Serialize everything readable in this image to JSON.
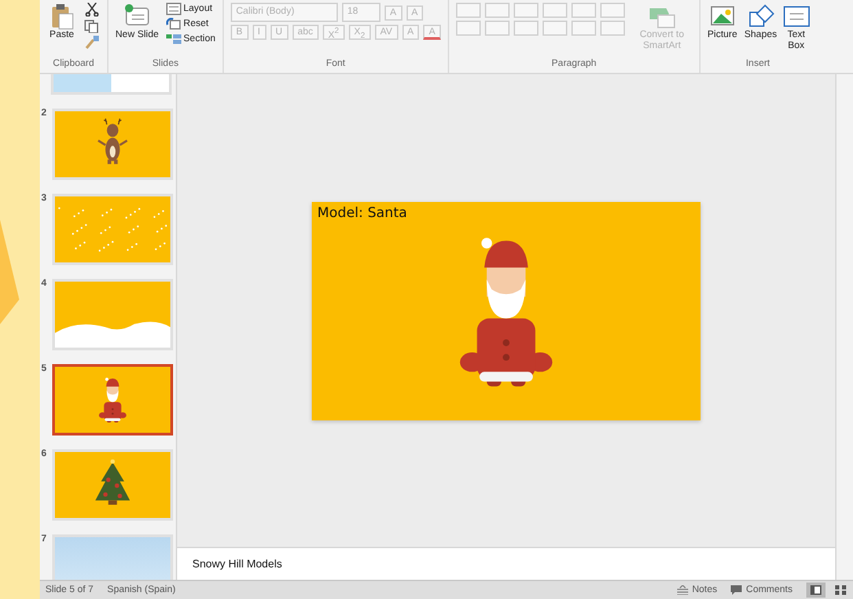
{
  "ribbon": {
    "clipboard": {
      "paste": "Paste",
      "label": "Clipboard"
    },
    "slides": {
      "new_slide": "New Slide",
      "layout": "Layout",
      "reset": "Reset",
      "section": "Section",
      "label": "Slides"
    },
    "font": {
      "disabled": true,
      "font_name": "Calibri (Body)",
      "font_size": "18",
      "size_buttons": [
        "A",
        "A"
      ],
      "format_buttons": [
        "B",
        "I",
        "U",
        "abc",
        "X$^{2}$",
        "X$_{2}$",
        "AV",
        "A"
      ],
      "font_color": "A",
      "label": "Font"
    },
    "paragraph": {
      "disabled": true,
      "convert": "Convert to SmartArt",
      "label": "Paragraph"
    },
    "insert": {
      "picture": "Picture",
      "shapes": "Shapes",
      "text_box": "Text Box",
      "label": "Insert"
    }
  },
  "slides": [
    {
      "kind": "collage",
      "selected": false
    },
    {
      "number": "2",
      "kind": "reindeer",
      "selected": false
    },
    {
      "number": "3",
      "kind": "snow",
      "selected": false
    },
    {
      "number": "4",
      "kind": "hills",
      "selected": false
    },
    {
      "number": "5",
      "kind": "santa",
      "selected": true
    },
    {
      "number": "6",
      "kind": "tree",
      "selected": false
    },
    {
      "number": "7",
      "kind": "sky",
      "selected": false
    }
  ],
  "current_slide": {
    "title": "Model: Santa",
    "kind": "santa"
  },
  "notes": "Snowy Hill Models",
  "status_bar": {
    "slide_info": "Slide 5 of 7",
    "language": "Spanish (Spain)",
    "notes": "Notes",
    "comments": "Comments",
    "views": [
      {
        "selected": true
      },
      {
        "selected": false
      }
    ]
  }
}
